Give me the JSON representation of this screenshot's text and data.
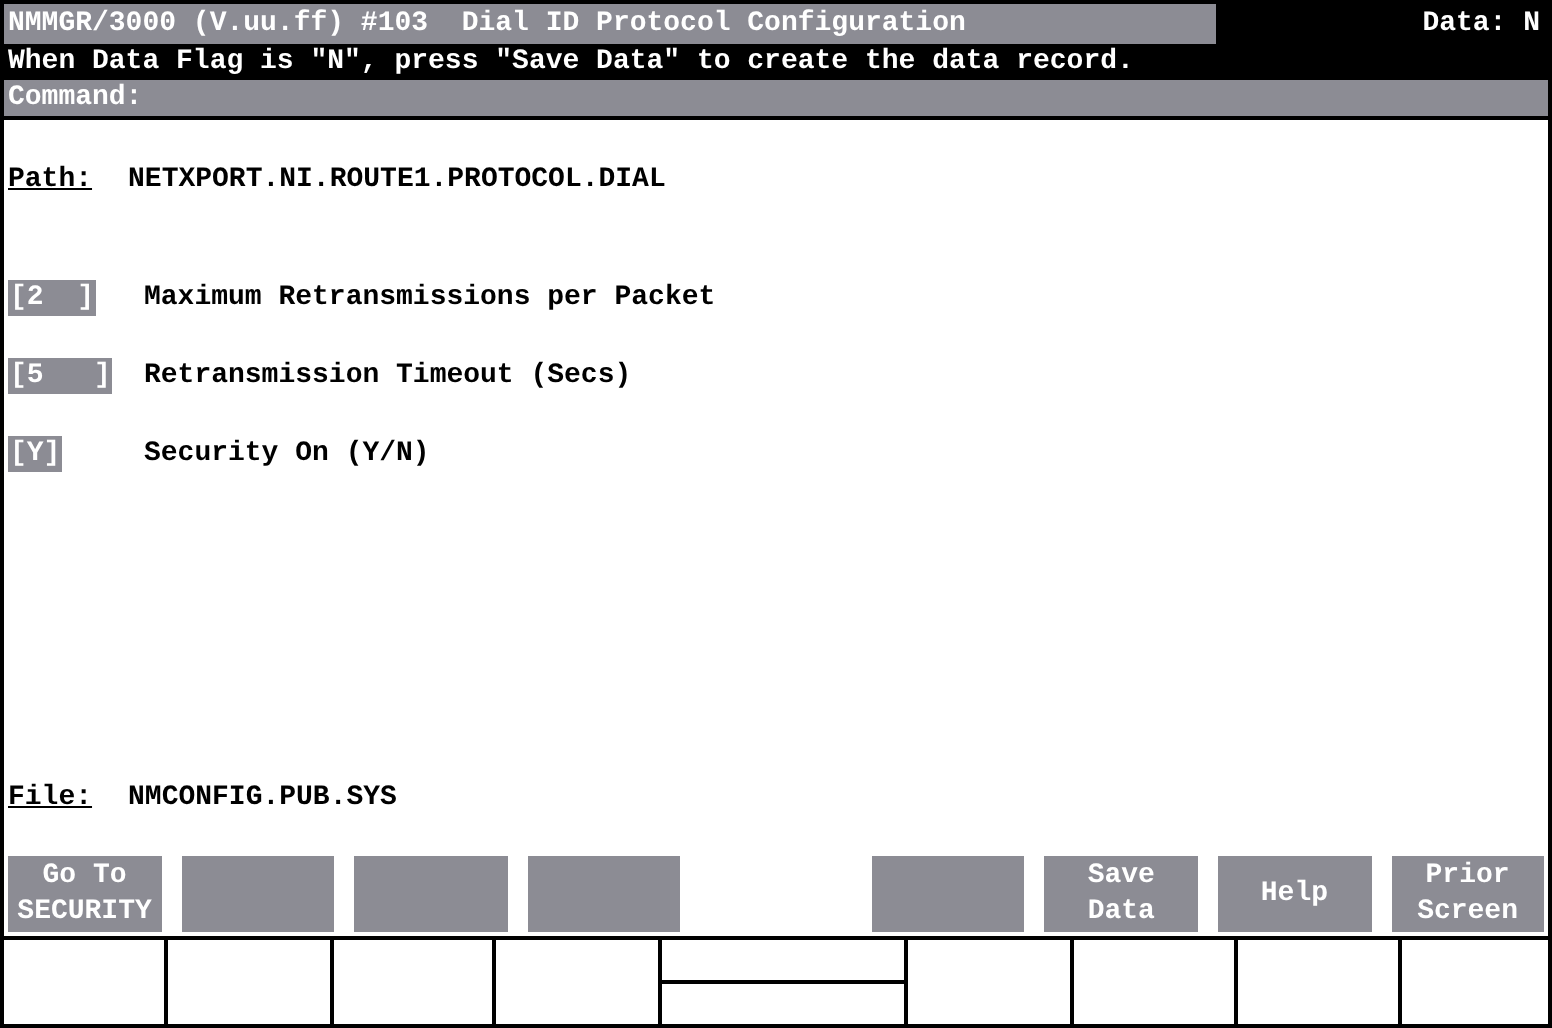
{
  "header": {
    "title": "NMMGR/3000 (V.uu.ff) #103  Dial ID Protocol Configuration",
    "data_flag": "Data: N",
    "message": "When Data Flag is \"N\", press \"Save Data\" to create the data record.",
    "command_label": "Command:"
  },
  "path": {
    "label": "Path:",
    "value": "NETXPORT.NI.ROUTE1.PROTOCOL.DIAL"
  },
  "fields": [
    {
      "value": "[2  ]",
      "label": "Maximum Retransmissions per Packet"
    },
    {
      "value": "[5   ]",
      "label": "Retransmission Timeout (Secs)"
    },
    {
      "value": "[Y]",
      "label": "Security On (Y/N)"
    }
  ],
  "file": {
    "label": "File:",
    "value": "NMCONFIG.PUB.SYS"
  },
  "softkeys": [
    {
      "kind": "labeled",
      "lines": [
        "Go To",
        "SECURITY"
      ]
    },
    {
      "kind": "blank"
    },
    {
      "kind": "blank"
    },
    {
      "kind": "blank"
    },
    {
      "kind": "gap"
    },
    {
      "kind": "blank"
    },
    {
      "kind": "labeled",
      "lines": [
        "Save",
        "Data"
      ]
    },
    {
      "kind": "labeled",
      "lines": [
        "Help"
      ]
    },
    {
      "kind": "labeled",
      "lines": [
        "Prior",
        "Screen"
      ]
    }
  ]
}
